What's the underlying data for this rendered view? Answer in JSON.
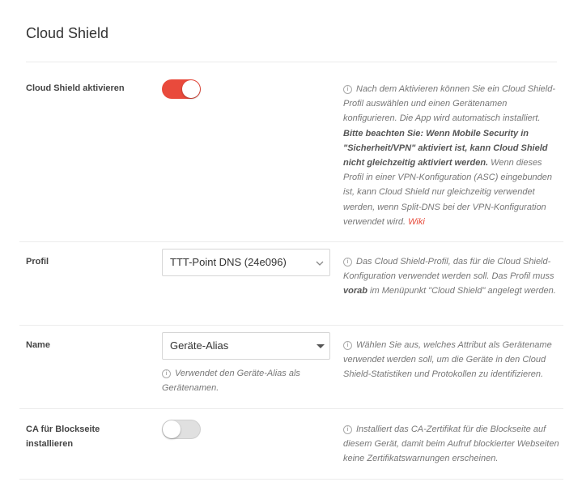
{
  "page": {
    "title": "Cloud Shield"
  },
  "rows": {
    "activate": {
      "label": "Cloud Shield aktivieren",
      "toggle_on": true,
      "help_part1": "Nach dem Aktivieren können Sie ein Cloud Shield-Profil auswählen und einen Gerätenamen konfigurieren. Die App wird automatisch installiert.",
      "help_bold": "Bitte beachten Sie: Wenn Mobile Security in \"Sicherheit/VPN\" aktiviert ist, kann Cloud Shield nicht gleichzeitig aktiviert werden.",
      "help_part2": "Wenn dieses Profil in einer VPN-Konfiguration (ASC) eingebunden ist, kann Cloud Shield nur gleichzeitig verwendet werden, wenn Split-DNS bei der VPN-Konfiguration verwendet wird.",
      "wiki_link": "Wiki"
    },
    "profile": {
      "label": "Profil",
      "selected": "TTT-Point DNS (24e096)",
      "help_part1": "Das Cloud Shield-Profil, das für die Cloud Shield-Konfiguration verwendet werden soll. Das Profil muss",
      "help_bold": "vorab",
      "help_part2": "im Menüpunkt \"Cloud Shield\" angelegt werden."
    },
    "name": {
      "label": "Name",
      "selected": "Geräte-Alias",
      "field_help": "Verwendet den Geräte-Alias als Gerätenamen.",
      "help": "Wählen Sie aus, welches Attribut als Gerätename verwendet werden soll, um die Geräte in den Cloud Shield-Statistiken und Protokollen zu identifizieren."
    },
    "ca": {
      "label": "CA für Blockseite installieren",
      "toggle_on": false,
      "help": "Installiert das CA-Zertifikat für die Blockseite auf diesem Gerät, damit beim Aufruf blockierter Webseiten keine Zertifikatswarnungen erscheinen."
    }
  },
  "colors": {
    "accent": "#e94a3c",
    "toggle_off": "#e0e0e0"
  },
  "icons": {
    "info": "info-circle-icon",
    "select_chevron": "chevron-down-icon",
    "select_caret": "caret-down-icon"
  }
}
